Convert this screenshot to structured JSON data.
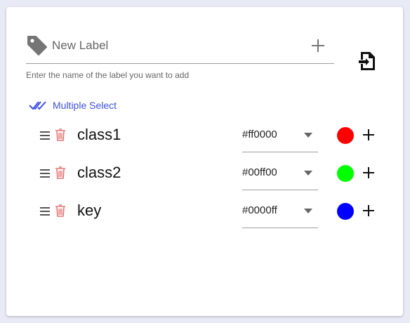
{
  "new_label": {
    "placeholder": "New Label",
    "value": "",
    "hint": "Enter the name of the label you want to add"
  },
  "multiple_select": {
    "label": "Multiple Select"
  },
  "labels": [
    {
      "name": "class1",
      "color": "#ff0000"
    },
    {
      "name": "class2",
      "color": "#00ff00"
    },
    {
      "name": "key",
      "color": "#0000ff"
    }
  ],
  "icons": {
    "tag": "tag-icon",
    "add": "plus-icon",
    "import": "file-import-icon",
    "multi_select": "double-check-icon",
    "drag": "drag-handle-icon",
    "delete": "trash-icon",
    "dropdown": "caret-down-icon"
  },
  "colors": {
    "accent": "#3f51e5",
    "tag_icon": "#757575",
    "trash": "#e57373",
    "line": "#9e9e9e"
  }
}
